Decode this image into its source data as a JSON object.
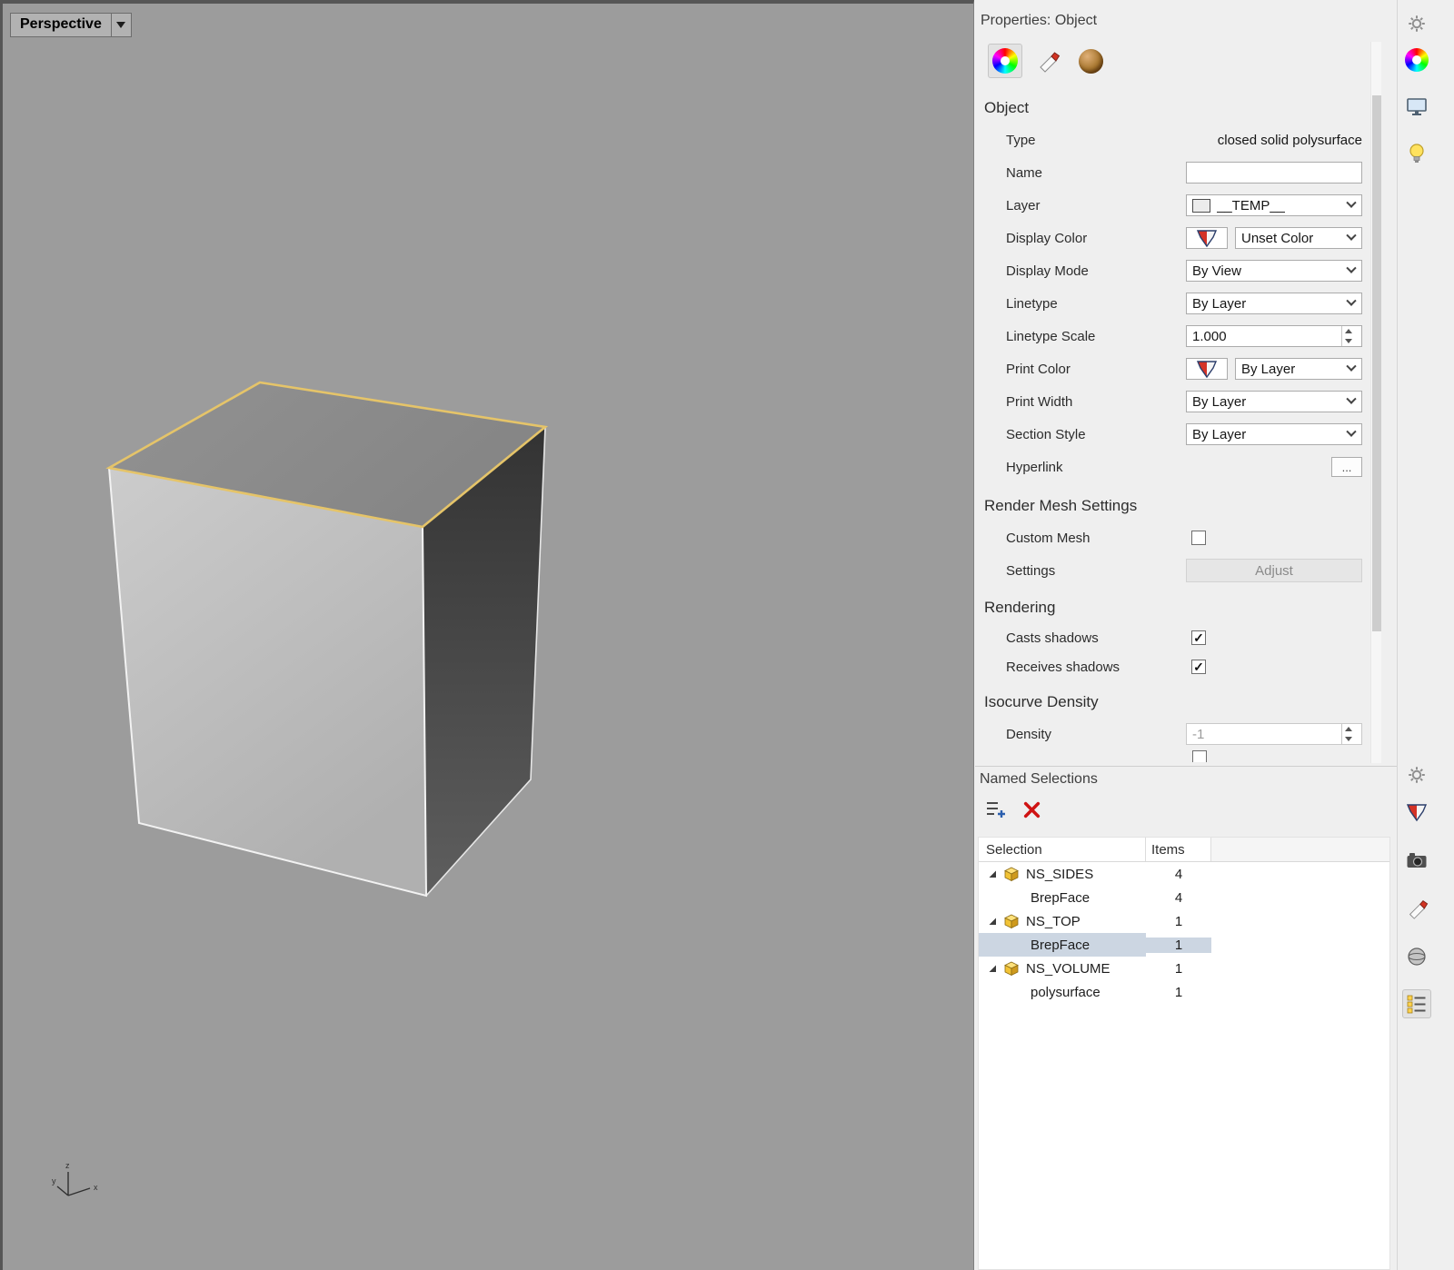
{
  "viewport": {
    "label": "Perspective",
    "axes": {
      "x": "x",
      "y": "y",
      "z": "z"
    }
  },
  "properties": {
    "header": "Properties: Object",
    "object_section": "Object",
    "type": {
      "label": "Type",
      "value": "closed solid polysurface"
    },
    "name": {
      "label": "Name",
      "value": ""
    },
    "layer": {
      "label": "Layer",
      "value": "__TEMP__"
    },
    "display_color": {
      "label": "Display Color",
      "value": "Unset Color"
    },
    "display_mode": {
      "label": "Display Mode",
      "value": "By View"
    },
    "linetype": {
      "label": "Linetype",
      "value": "By Layer"
    },
    "linetype_scale": {
      "label": "Linetype Scale",
      "value": "1.000"
    },
    "print_color": {
      "label": "Print Color",
      "value": "By Layer"
    },
    "print_width": {
      "label": "Print Width",
      "value": "By Layer"
    },
    "section_style": {
      "label": "Section Style",
      "value": "By Layer"
    },
    "hyperlink": {
      "label": "Hyperlink",
      "button_label": "..."
    },
    "render_mesh_section": "Render Mesh Settings",
    "custom_mesh": {
      "label": "Custom Mesh",
      "checked": false
    },
    "settings": {
      "label": "Settings",
      "button_label": "Adjust"
    },
    "rendering_section": "Rendering",
    "casts_shadows": {
      "label": "Casts shadows",
      "checked": true
    },
    "receives_shadows": {
      "label": "Receives shadows",
      "checked": true
    },
    "isocurve_section": "Isocurve Density",
    "density": {
      "label": "Density",
      "value": "-1"
    }
  },
  "named_selections": {
    "header": "Named Selections",
    "columns": {
      "selection": "Selection",
      "items": "Items"
    },
    "rows": [
      {
        "name": "NS_SIDES",
        "items": "4",
        "type": "group"
      },
      {
        "name": "BrepFace",
        "items": "4",
        "type": "child"
      },
      {
        "name": "NS_TOP",
        "items": "1",
        "type": "group"
      },
      {
        "name": "BrepFace",
        "items": "1",
        "type": "child",
        "selected": true
      },
      {
        "name": "NS_VOLUME",
        "items": "1",
        "type": "group"
      },
      {
        "name": "polysurface",
        "items": "1",
        "type": "child"
      }
    ]
  },
  "colors": {
    "selection_highlight": "#ccd6e2",
    "selected_edge": "#e5c469",
    "viewport_background": "#9c9c9c"
  }
}
